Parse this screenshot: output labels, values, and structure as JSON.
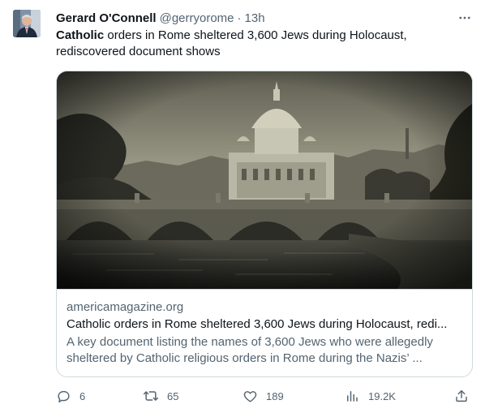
{
  "tweet": {
    "author_name": "Gerard O'Connell",
    "handle": "@gerryorome",
    "separator": "·",
    "time": "13h",
    "text_bold": "Catholic",
    "text_rest": " orders in Rome sheltered 3,600 Jews during Holocaust, rediscovered document shows"
  },
  "card": {
    "domain": "americamagazine.org",
    "title": "Catholic orders in Rome sheltered 3,600 Jews during Holocaust, redi...",
    "description": "A key document listing the names of 3,600 Jews who were allegedly sheltered by Catholic religious orders in Rome during the Nazis’ ..."
  },
  "actions": {
    "replies": "6",
    "retweets": "65",
    "likes": "189",
    "views": "19.2K"
  },
  "icons": {
    "more": "more-icon",
    "reply": "reply-icon",
    "retweet": "retweet-icon",
    "like": "heart-icon",
    "views": "views-icon",
    "share": "share-icon"
  },
  "colors": {
    "text_primary": "#0f1419",
    "text_secondary": "#536471",
    "border": "#cfd9de"
  }
}
